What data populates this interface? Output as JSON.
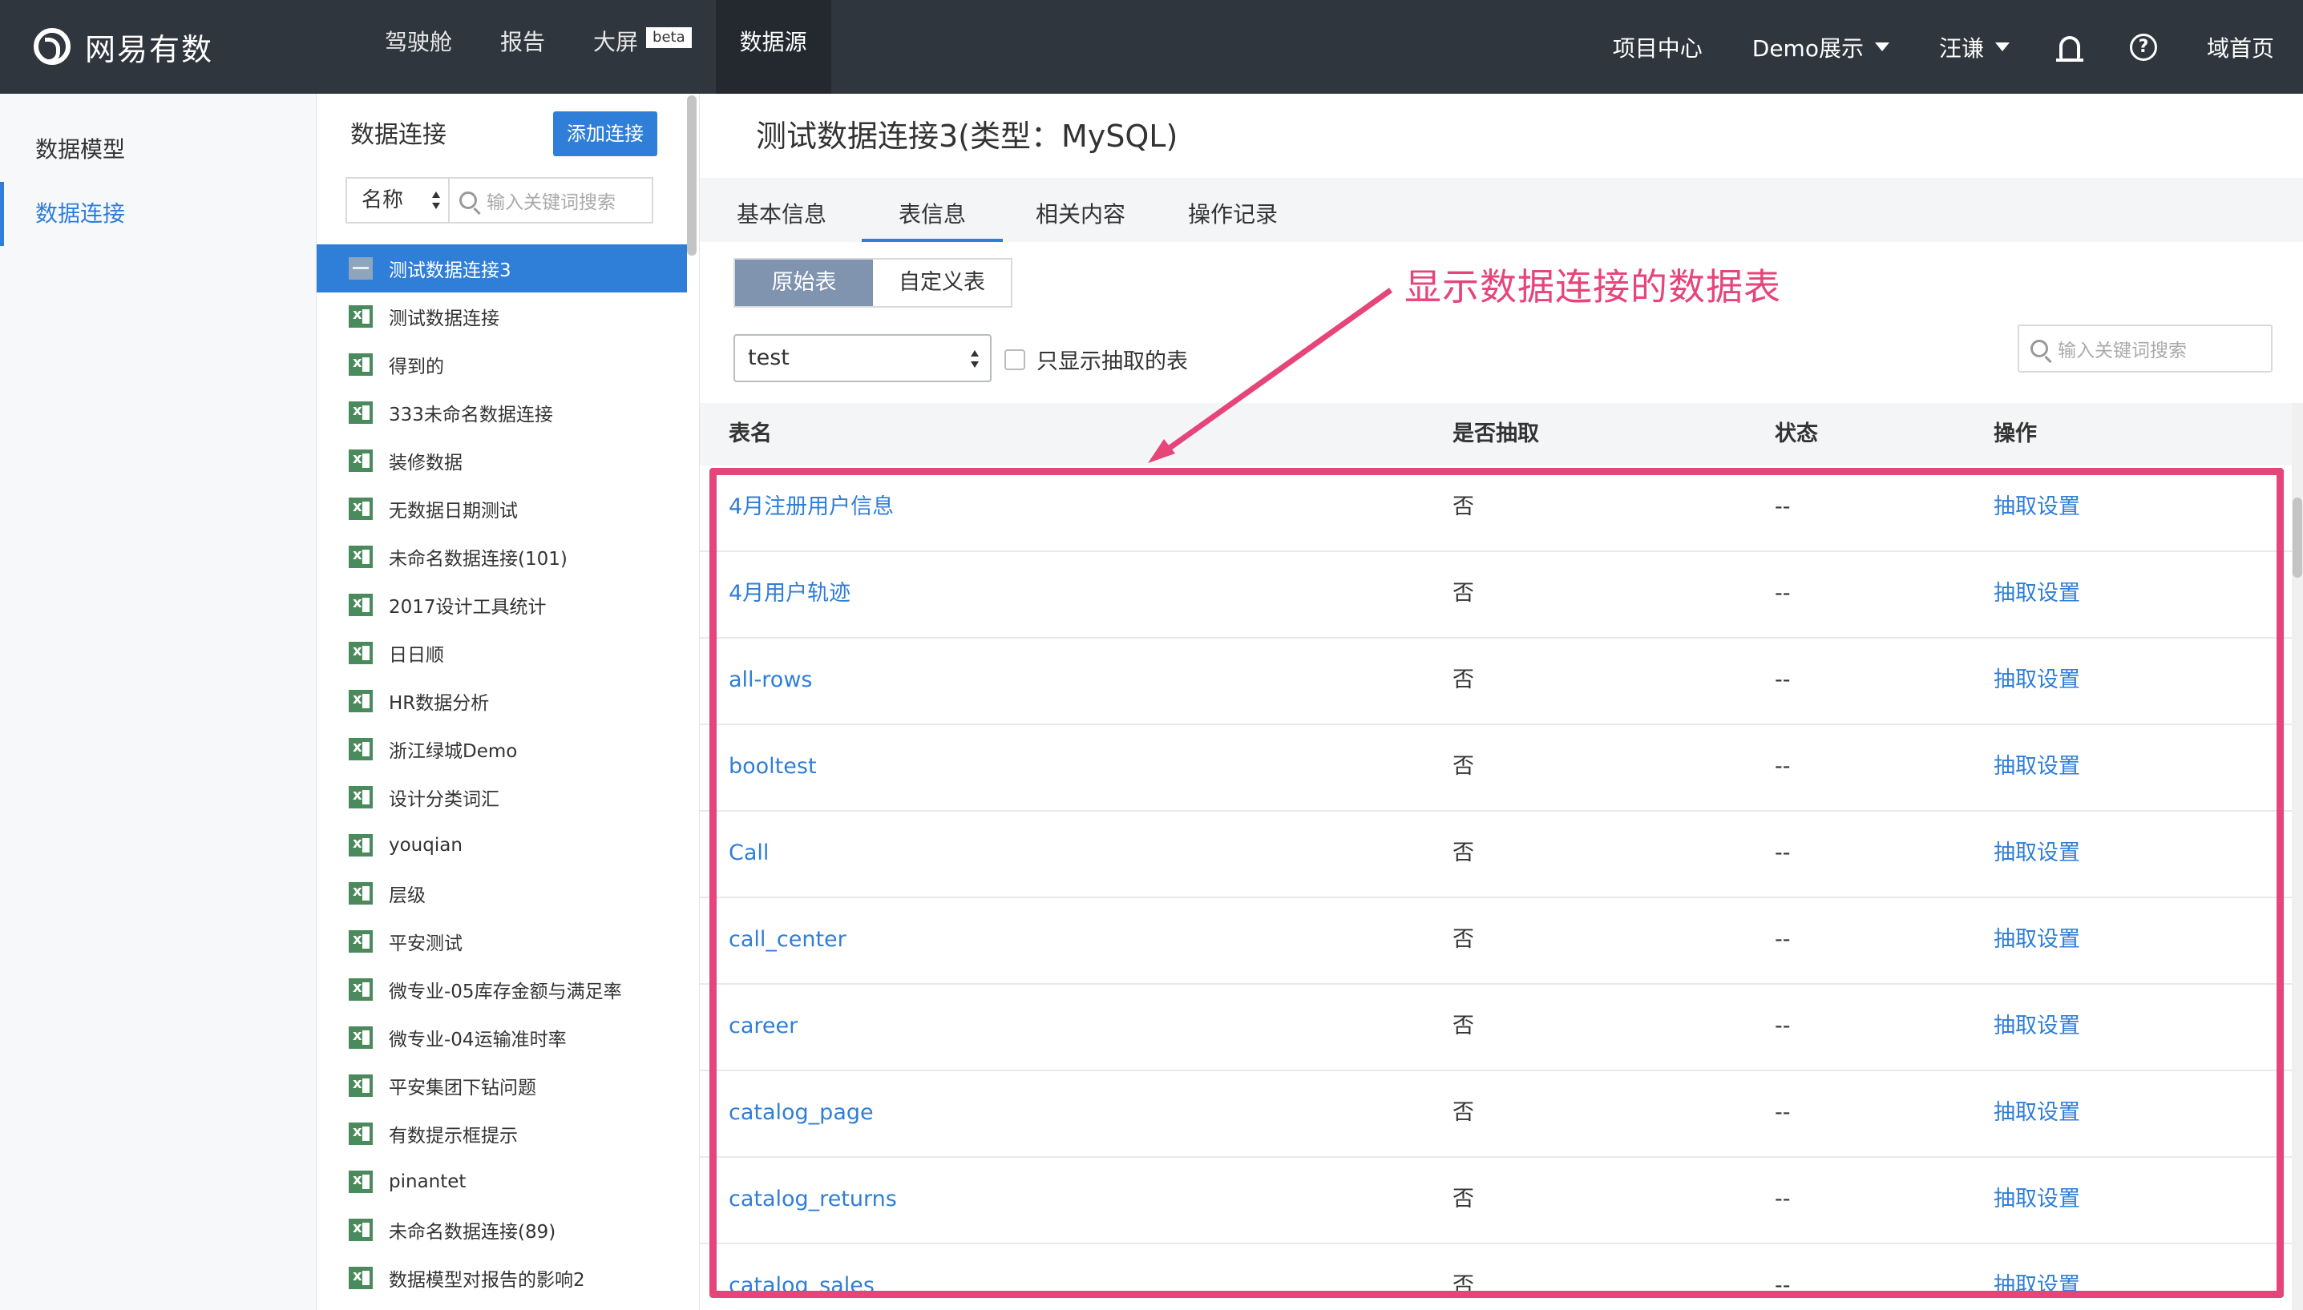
{
  "topbar": {
    "logo_text": "网易有数",
    "nav": [
      {
        "label": "驾驶舱"
      },
      {
        "label": "报告"
      },
      {
        "label": "大屏",
        "badge": "beta"
      },
      {
        "label": "数据源",
        "active": true
      }
    ],
    "right": {
      "project_center": "项目中心",
      "demo": "Demo展示",
      "user": "汪谦",
      "home": "域首页"
    },
    "icons": [
      "bell-icon",
      "help-icon"
    ]
  },
  "left_nav": {
    "items": [
      {
        "label": "数据模型"
      },
      {
        "label": "数据连接",
        "active": true
      }
    ]
  },
  "connections": {
    "title": "数据连接",
    "add_button": "添加连接",
    "filter_select": "名称",
    "search_placeholder": "输入关键词搜索",
    "items": [
      {
        "label": "测试数据连接3",
        "icon": "mysql-icon",
        "active": true
      },
      {
        "label": "测试数据连接",
        "icon": "excel-icon"
      },
      {
        "label": "得到的",
        "icon": "excel-icon"
      },
      {
        "label": "333未命名数据连接",
        "icon": "excel-icon"
      },
      {
        "label": "装修数据",
        "icon": "excel-icon"
      },
      {
        "label": "无数据日期测试",
        "icon": "excel-icon"
      },
      {
        "label": "未命名数据连接(101)",
        "icon": "excel-icon"
      },
      {
        "label": "2017设计工具统计",
        "icon": "excel-icon"
      },
      {
        "label": "日日顺",
        "icon": "excel-icon"
      },
      {
        "label": "HR数据分析",
        "icon": "excel-icon"
      },
      {
        "label": "浙江绿城Demo",
        "icon": "excel-icon"
      },
      {
        "label": "设计分类词汇",
        "icon": "excel-icon"
      },
      {
        "label": "youqian",
        "icon": "excel-icon"
      },
      {
        "label": "层级",
        "icon": "excel-icon"
      },
      {
        "label": "平安测试",
        "icon": "excel-icon"
      },
      {
        "label": "微专业-05库存金额与满足率",
        "icon": "excel-icon"
      },
      {
        "label": "微专业-04运输准时率",
        "icon": "excel-icon"
      },
      {
        "label": "平安集团下钻问题",
        "icon": "excel-icon"
      },
      {
        "label": "有数提示框提示",
        "icon": "excel-icon"
      },
      {
        "label": "pinantet",
        "icon": "excel-icon"
      },
      {
        "label": "未命名数据连接(89)",
        "icon": "excel-icon"
      },
      {
        "label": "数据模型对报告的影响2",
        "icon": "excel-icon"
      }
    ]
  },
  "main": {
    "title": "测试数据连接3(类型：MySQL)",
    "tabs": [
      {
        "label": "基本信息"
      },
      {
        "label": "表信息",
        "active": true
      },
      {
        "label": "相关内容"
      },
      {
        "label": "操作记录"
      }
    ],
    "segments": [
      {
        "label": "原始表",
        "active": true
      },
      {
        "label": "自定义表"
      }
    ],
    "database_select": "test",
    "only_extracted_label": "只显示抽取的表",
    "search_placeholder": "输入关键词搜索",
    "table": {
      "columns": [
        "表名",
        "是否抽取",
        "状态",
        "操作"
      ],
      "rows": [
        {
          "name": "4月注册用户信息",
          "extracted": "否",
          "status": "--",
          "action": "抽取设置"
        },
        {
          "name": "4月用户轨迹",
          "extracted": "否",
          "status": "--",
          "action": "抽取设置"
        },
        {
          "name": "all-rows",
          "extracted": "否",
          "status": "--",
          "action": "抽取设置"
        },
        {
          "name": "booltest",
          "extracted": "否",
          "status": "--",
          "action": "抽取设置"
        },
        {
          "name": "Call",
          "extracted": "否",
          "status": "--",
          "action": "抽取设置"
        },
        {
          "name": "call_center",
          "extracted": "否",
          "status": "--",
          "action": "抽取设置"
        },
        {
          "name": "career",
          "extracted": "否",
          "status": "--",
          "action": "抽取设置"
        },
        {
          "name": "catalog_page",
          "extracted": "否",
          "status": "--",
          "action": "抽取设置"
        },
        {
          "name": "catalog_returns",
          "extracted": "否",
          "status": "--",
          "action": "抽取设置"
        },
        {
          "name": "catalog_sales",
          "extracted": "否",
          "status": "--",
          "action": "抽取设置"
        }
      ]
    }
  },
  "annotation": {
    "text": "显示数据连接的数据表",
    "color": "#e6457a"
  },
  "colors": {
    "accent": "#2f7ed8",
    "topbar": "#30363d",
    "segment_active": "#8094b0"
  }
}
